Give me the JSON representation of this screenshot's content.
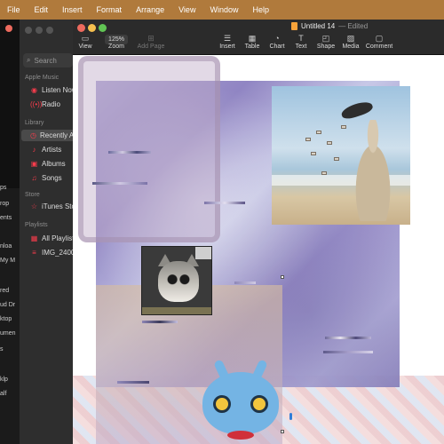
{
  "menubar": {
    "items": [
      "File",
      "Edit",
      "Insert",
      "Format",
      "Arrange",
      "View",
      "Window",
      "Help"
    ]
  },
  "music": {
    "search_placeholder": "Search",
    "sections": {
      "apple_music": "Apple Music",
      "library": "Library",
      "store": "Store",
      "playlists": "Playlists"
    },
    "apple_music_items": [
      {
        "label": "Listen Now",
        "icon": "play-circle-icon"
      },
      {
        "label": "Radio",
        "icon": "radio-icon"
      }
    ],
    "library_items": [
      {
        "label": "Recently Added",
        "icon": "clock-icon",
        "selected": true
      },
      {
        "label": "Artists",
        "icon": "mic-icon"
      },
      {
        "label": "Albums",
        "icon": "album-icon"
      },
      {
        "label": "Songs",
        "icon": "note-icon"
      }
    ],
    "store_items": [
      {
        "label": "iTunes Store",
        "icon": "star-icon"
      }
    ],
    "playlist_items": [
      {
        "label": "All Playlists",
        "icon": "grid-icon"
      },
      {
        "label": "IMG_2400",
        "icon": "playlist-icon"
      }
    ],
    "left_fragments": [
      "ps",
      "rop",
      "ents",
      "My M",
      "nloa",
      "red",
      "ud Dr",
      "ktop",
      "umen",
      "s",
      "klp",
      "alf"
    ]
  },
  "pages": {
    "title": "Untitled 14",
    "status": "— Edited",
    "toolbar": [
      {
        "label": "View",
        "icon": "sidebar-icon",
        "enabled": true
      },
      {
        "label": "Zoom",
        "icon": "zoom-menu",
        "value": "125%",
        "enabled": true
      },
      {
        "label": "Add Page",
        "icon": "add-page-icon",
        "enabled": false
      },
      {
        "label": "Insert",
        "icon": "insert-icon",
        "enabled": true
      },
      {
        "label": "Table",
        "icon": "table-icon",
        "enabled": true
      },
      {
        "label": "Chart",
        "icon": "chart-icon",
        "enabled": true
      },
      {
        "label": "Text",
        "icon": "text-icon",
        "enabled": true
      },
      {
        "label": "Shape",
        "icon": "shape-icon",
        "enabled": true
      },
      {
        "label": "Media",
        "icon": "media-icon",
        "enabled": true
      },
      {
        "label": "Comment",
        "icon": "comment-icon",
        "enabled": true
      }
    ]
  },
  "colors": {
    "menubar_bg": "#b07a3c",
    "accent_red": "#fa3c4c",
    "traffic_close": "#ed6a5e",
    "traffic_min": "#f5bf4f",
    "traffic_zoom": "#61c554"
  }
}
